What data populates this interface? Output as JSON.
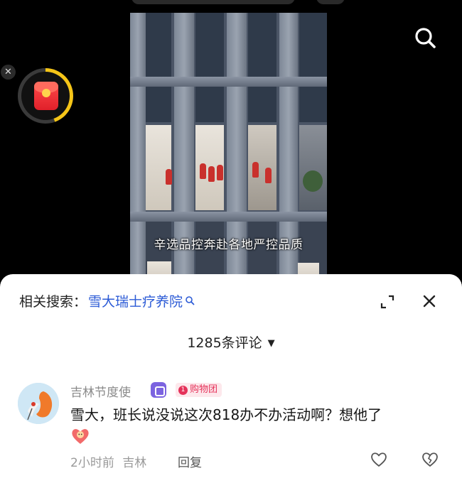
{
  "video": {
    "subtitle": "辛选品控奔赴各地严控品质"
  },
  "icons": {
    "close": "close-icon",
    "red_packet": "red-packet-icon",
    "search": "search-icon",
    "expand": "expand-icon",
    "sort": "chevron-down-icon",
    "like": "heart-icon",
    "dislike": "broken-heart-icon"
  },
  "colors": {
    "link_blue": "#2c5bd6",
    "badge_pink": "#e5325a",
    "ring_yellow": "#f5c518"
  },
  "comments_panel": {
    "related_label": "相关搜索：",
    "related_query": "雪大瑞士疗养院",
    "comment_count": "1285条评论",
    "sort_caret": "▼"
  },
  "comment": {
    "username": "吉林节度使",
    "group_badge_num": "1",
    "group_badge": "购物团",
    "text": "雪大，班长说没说这次818办不办活动啊？想他了",
    "time": "2小时前",
    "location": "吉林",
    "reply": "回复"
  }
}
